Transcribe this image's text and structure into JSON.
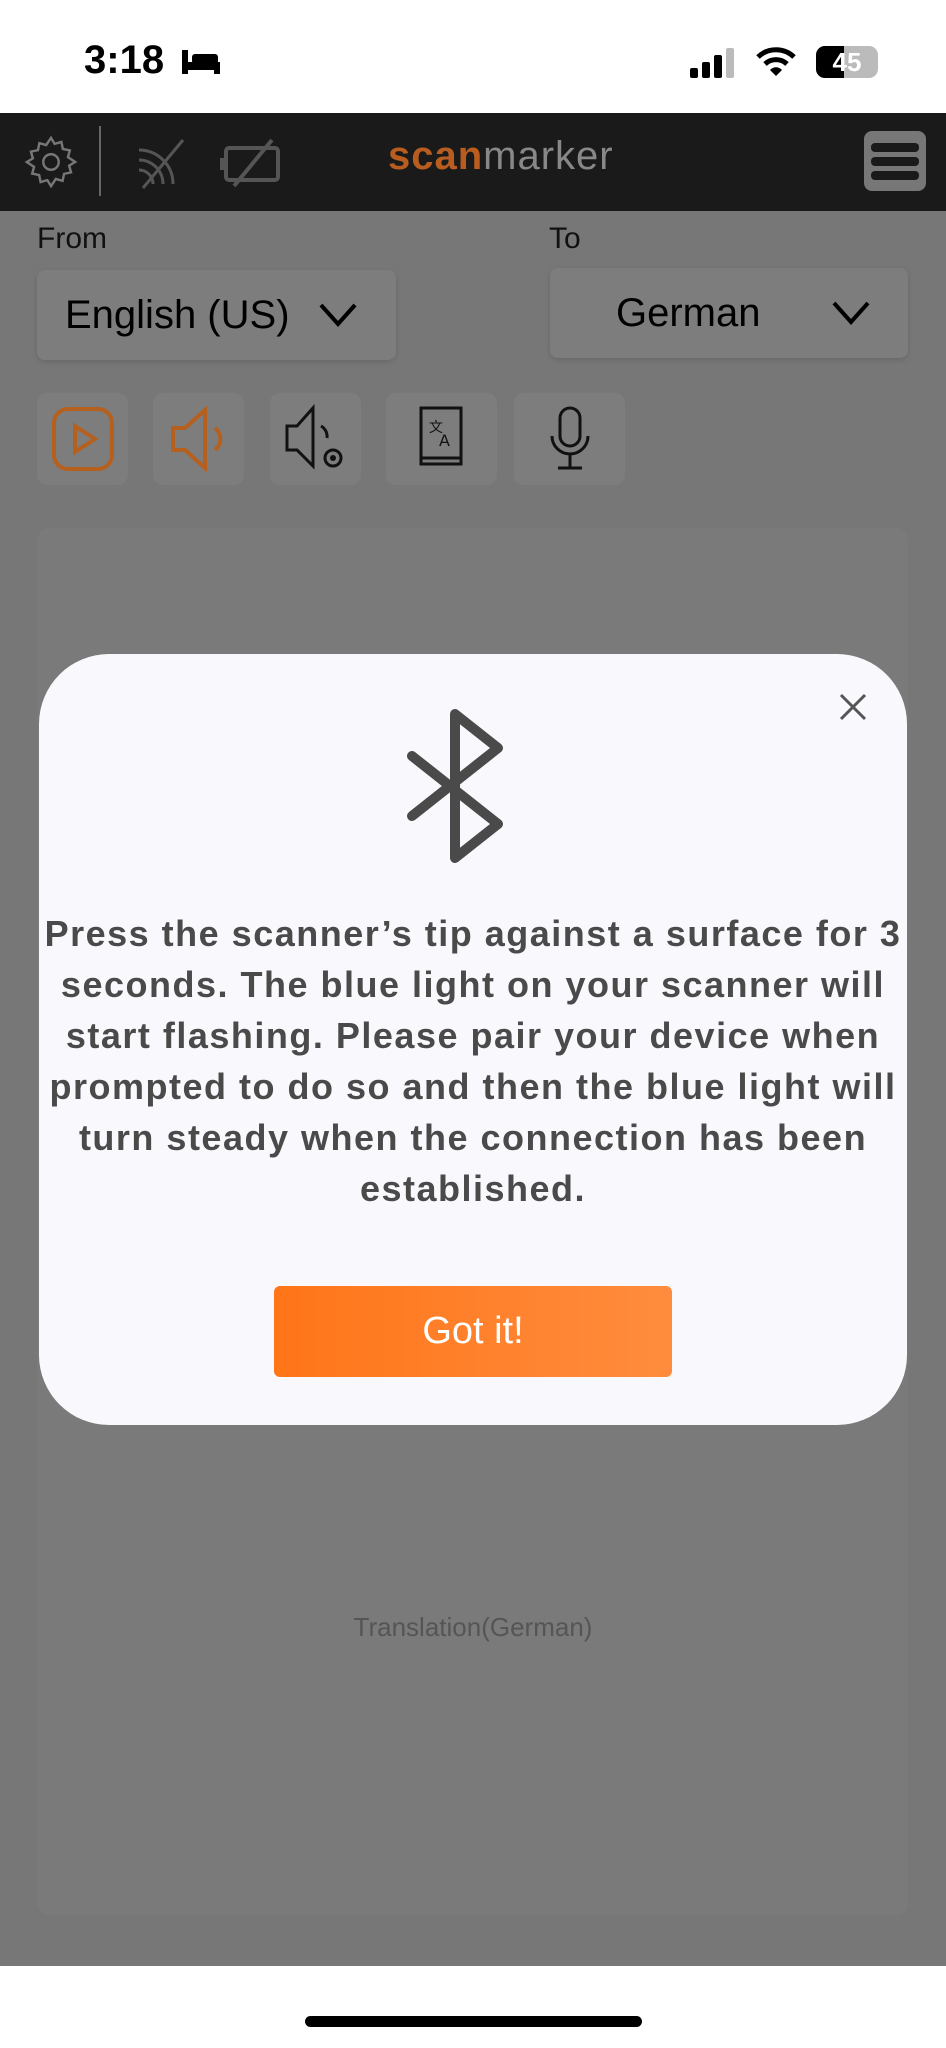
{
  "status_bar": {
    "time": "3:18",
    "battery": "45",
    "icons": [
      "bed-icon",
      "signal-icon",
      "wifi-icon",
      "battery-icon"
    ]
  },
  "header": {
    "brand_prefix": "scan",
    "brand_suffix": "marker",
    "icons": [
      "gear-icon",
      "scanner-disconnected-icon",
      "battery-disconnected-icon",
      "menu-icon"
    ]
  },
  "languages": {
    "from_label": "From",
    "from_value": "English (US)",
    "to_label": "To",
    "to_value": "German"
  },
  "toolbar": {
    "icons": [
      "play-icon",
      "speaker-icon",
      "speech-settings-icon",
      "dictionary-icon",
      "microphone-icon"
    ]
  },
  "translation_placeholder": "Translation(German)",
  "modal": {
    "icon": "bluetooth-icon",
    "message": "Press the scanner’s tip against a surface for 3 seconds. The blue light on your scanner will start flashing. Please pair your device when prompted to do so and then the blue light will turn steady when the connection has been established.",
    "button": "Got it!"
  },
  "colors": {
    "accent": "#ff7a1a",
    "header": "#1a1a1a",
    "overlay": "#777777"
  }
}
